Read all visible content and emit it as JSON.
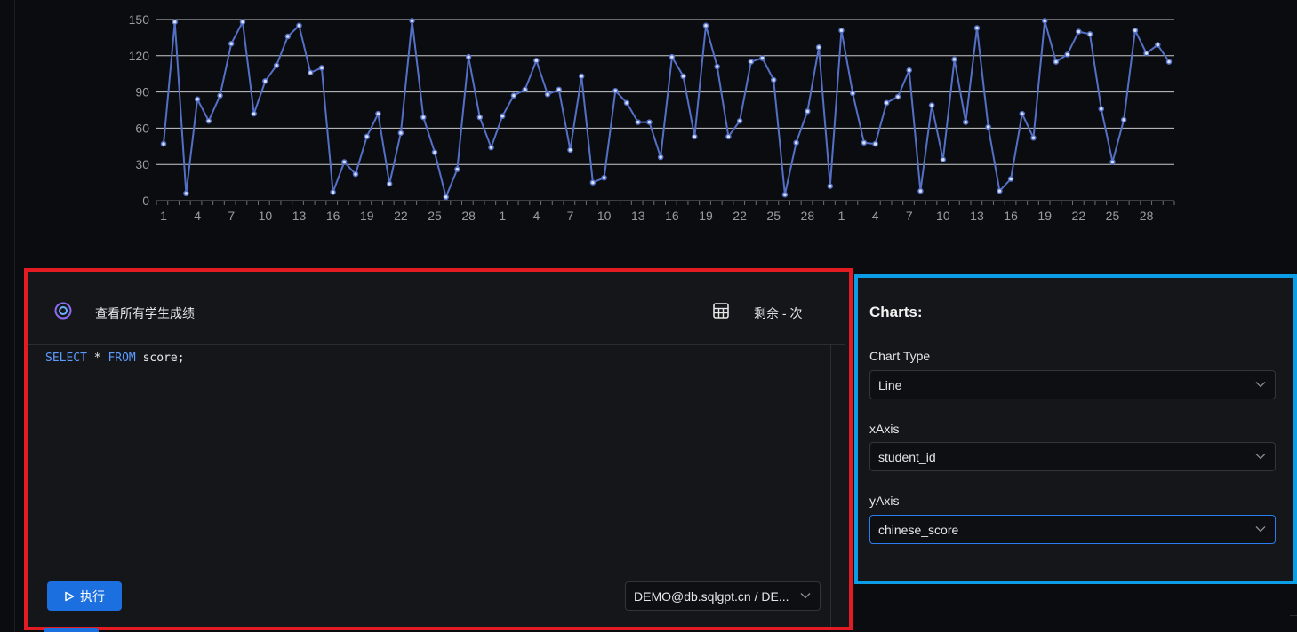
{
  "chart_data": {
    "type": "line",
    "title": "",
    "xlabel": "",
    "ylabel": "",
    "ylim": [
      0,
      150
    ],
    "yticks": [
      0,
      30,
      60,
      90,
      120,
      150
    ],
    "xticks": [
      "1",
      "4",
      "7",
      "10",
      "13",
      "16",
      "19",
      "22",
      "25",
      "28",
      "1",
      "4",
      "7",
      "10",
      "13",
      "16",
      "19",
      "22",
      "25",
      "28",
      "1",
      "4",
      "7",
      "10",
      "13",
      "16",
      "19",
      "22",
      "25",
      "28"
    ],
    "color": "#5470c6",
    "series": [
      {
        "values": [
          47,
          148,
          6,
          84,
          66,
          87,
          130,
          148,
          72,
          99,
          112,
          136,
          145,
          106,
          110,
          7,
          32,
          22,
          53,
          72,
          14,
          56,
          149,
          69,
          40,
          3,
          26,
          119,
          69,
          44,
          70,
          87,
          92,
          116,
          88,
          92,
          42,
          103,
          15,
          19,
          91,
          81,
          65,
          65,
          36,
          119,
          103,
          53,
          145,
          111,
          53,
          66,
          115,
          118,
          100,
          5,
          48,
          74,
          127,
          12,
          141,
          89,
          48,
          47,
          81,
          86,
          108,
          8,
          79,
          34,
          117,
          65,
          143,
          61,
          8,
          18,
          72,
          52,
          149,
          115,
          121,
          140,
          138,
          76,
          32,
          67,
          141,
          122,
          129,
          115
        ]
      }
    ]
  },
  "sql_panel": {
    "query_title": "查看所有学生成绩",
    "remaining": "剩余 - 次",
    "code": {
      "kw1": "SELECT",
      "star": " * ",
      "kw2": "FROM",
      "rest": " score;"
    },
    "run_label": "执行",
    "connection": "DEMO@db.sqlgpt.cn / DE..."
  },
  "charts_panel": {
    "title": "Charts:",
    "chart_type_label": "Chart Type",
    "chart_type_value": "Line",
    "xaxis_label": "xAxis",
    "xaxis_value": "student_id",
    "yaxis_label": "yAxis",
    "yaxis_value": "chinese_score"
  },
  "colors": {
    "accent": "#1b6fde",
    "highlight_red": "#e31b23",
    "highlight_blue": "#0b9ee6",
    "line": "#5470c6"
  }
}
